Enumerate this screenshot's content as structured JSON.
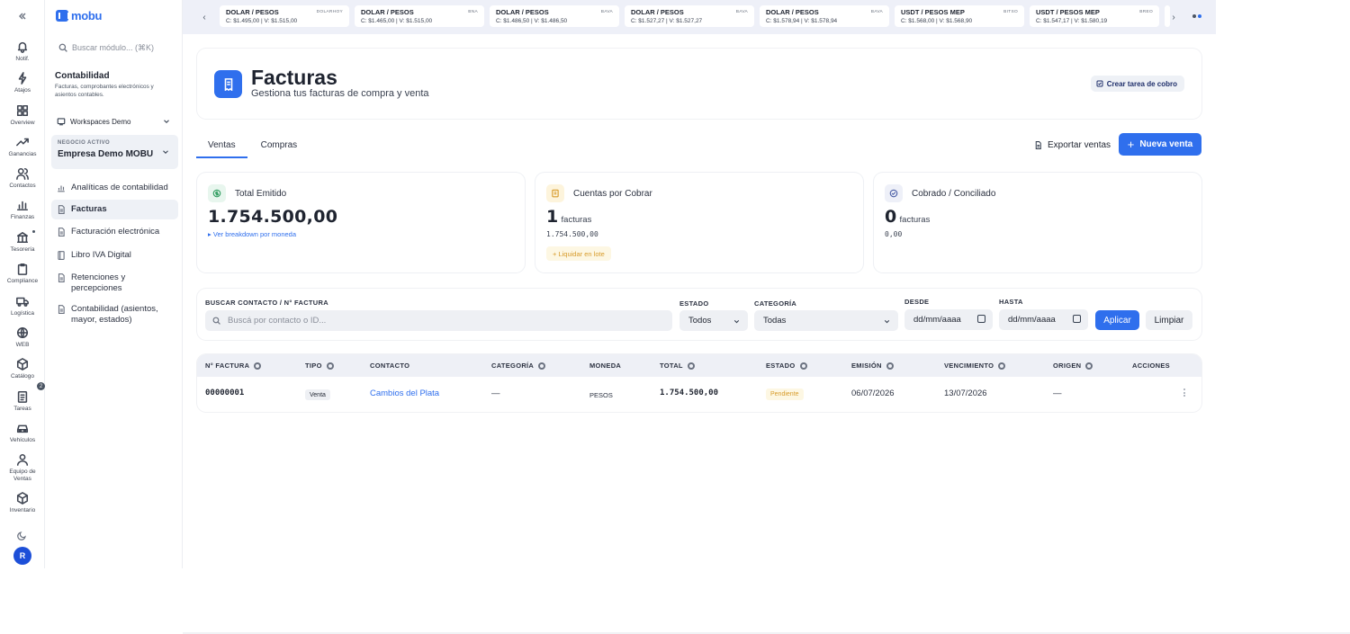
{
  "rail": {
    "items": [
      {
        "label": "Notif.",
        "icon": "bell-icon"
      },
      {
        "label": "Atajos",
        "icon": "bolt-icon"
      },
      {
        "label": "Overview",
        "icon": "grid-icon"
      },
      {
        "label": "Ganancias",
        "icon": "trend-up-icon"
      },
      {
        "label": "Contactos",
        "icon": "users-icon"
      },
      {
        "label": "Finanzas",
        "icon": "chart-icon"
      },
      {
        "label": "Tesorería",
        "icon": "bank-icon"
      },
      {
        "label": "Compliance",
        "icon": "clipboard-icon"
      },
      {
        "label": "Logística",
        "icon": "truck-icon"
      },
      {
        "label": "WEB",
        "icon": "globe-icon"
      },
      {
        "label": "Catálogo",
        "icon": "box-icon"
      },
      {
        "label": "Tareas",
        "icon": "tasks-icon"
      },
      {
        "label": "Vehículos",
        "icon": "car-icon"
      },
      {
        "label": "Equipo de Ventas",
        "icon": "team-icon"
      },
      {
        "label": "Inventario",
        "icon": "cube-icon"
      }
    ],
    "tasks_badge": "2",
    "avatar_initial": "R"
  },
  "sidebar": {
    "logo": "mobu",
    "search_placeholder": "Buscar módulo... (⌘K)",
    "module_title": "Contabilidad",
    "module_desc": "Facturas, comprobantes electrónicos y asientos contables.",
    "workspace": "Workspaces Demo",
    "business_label": "NEGOCIO ACTIVO",
    "business_name": "Empresa Demo MOBU",
    "nav": [
      {
        "label": "Analíticas de contabilidad",
        "active": false
      },
      {
        "label": "Facturas",
        "active": true
      },
      {
        "label": "Facturación electrónica",
        "active": false
      },
      {
        "label": "Libro IVA Digital",
        "active": false
      },
      {
        "label": "Retenciones y percepciones",
        "active": false
      },
      {
        "label": "Contabilidad (asientos, mayor, estados)",
        "active": false
      }
    ]
  },
  "ticker": [
    {
      "pair": "DOLAR / PESOS",
      "source": "DOLARHOY",
      "buy": "C: $1.495,00",
      "sell": "V: $1.515,00"
    },
    {
      "pair": "DOLAR / PESOS",
      "source": "BNA",
      "buy": "C: $1.465,00",
      "sell": "V: $1.515,00"
    },
    {
      "pair": "DOLAR / PESOS",
      "source": "BAVA",
      "buy": "C: $1.486,50",
      "sell": "V: $1.486,50"
    },
    {
      "pair": "DOLAR / PESOS",
      "source": "BAVA",
      "buy": "C: $1.527,27",
      "sell": "V: $1.527,27"
    },
    {
      "pair": "DOLAR / PESOS",
      "source": "BAVA",
      "buy": "C: $1.578,94",
      "sell": "V: $1.578,94"
    },
    {
      "pair": "USDT / PESOS MEP",
      "source": "BITSO",
      "buy": "C: $1.568,00",
      "sell": "V: $1.568,90"
    },
    {
      "pair": "USDT / PESOS MEP",
      "source": "BREO",
      "buy": "C: $1.547,17",
      "sell": "V: $1.580,19"
    }
  ],
  "header": {
    "title": "Facturas",
    "subtitle": "Gestiona tus facturas de compra y venta",
    "task_button": "Crear tarea de cobro"
  },
  "tabs": [
    "Ventas",
    "Compras"
  ],
  "actions": {
    "export": "Exportar ventas",
    "new_sale": "Nueva venta"
  },
  "kpis": {
    "total": {
      "title": "Total Emitido",
      "value": "1.754.500,00",
      "link": "Ver breakdown por moneda"
    },
    "receivable": {
      "title": "Cuentas por Cobrar",
      "count": "1",
      "unit": "facturas",
      "amount": "1.754.500,00",
      "action": "+ Liquidar en lote"
    },
    "collected": {
      "title": "Cobrado / Conciliado",
      "count": "0",
      "unit": "facturas",
      "amount": "0,00"
    }
  },
  "filters": {
    "search_label": "BUSCAR CONTACTO / N° FACTURA",
    "search_placeholder": "Buscá por contacto o ID...",
    "state_label": "ESTADO",
    "state_value": "Todos",
    "category_label": "CATEGORÍA",
    "category_value": "Todas",
    "from_label": "DESDE",
    "from_value": "dd/mm/aaaa",
    "to_label": "HASTA",
    "to_value": "dd/mm/aaaa",
    "apply": "Aplicar",
    "clear": "Limpiar"
  },
  "table": {
    "columns": [
      "N° FACTURA",
      "TIPO",
      "CONTACTO",
      "CATEGORÍA",
      "MONEDA",
      "TOTAL",
      "ESTADO",
      "EMISIÓN",
      "VENCIMIENTO",
      "ORIGEN",
      "ACCIONES"
    ],
    "rows": [
      {
        "number": "00000001",
        "type": "Venta",
        "contact": "Cambios del Plata",
        "category": "—",
        "currency": "PESOS",
        "total": "1.754.500,00",
        "state": "Pendiente",
        "issued": "06/07/2026",
        "due": "13/07/2026",
        "origin": "—"
      }
    ]
  },
  "colors": {
    "accent": "#2f6fed",
    "pending": "#d79b2b",
    "ticker_bg": "#eef0f8"
  }
}
